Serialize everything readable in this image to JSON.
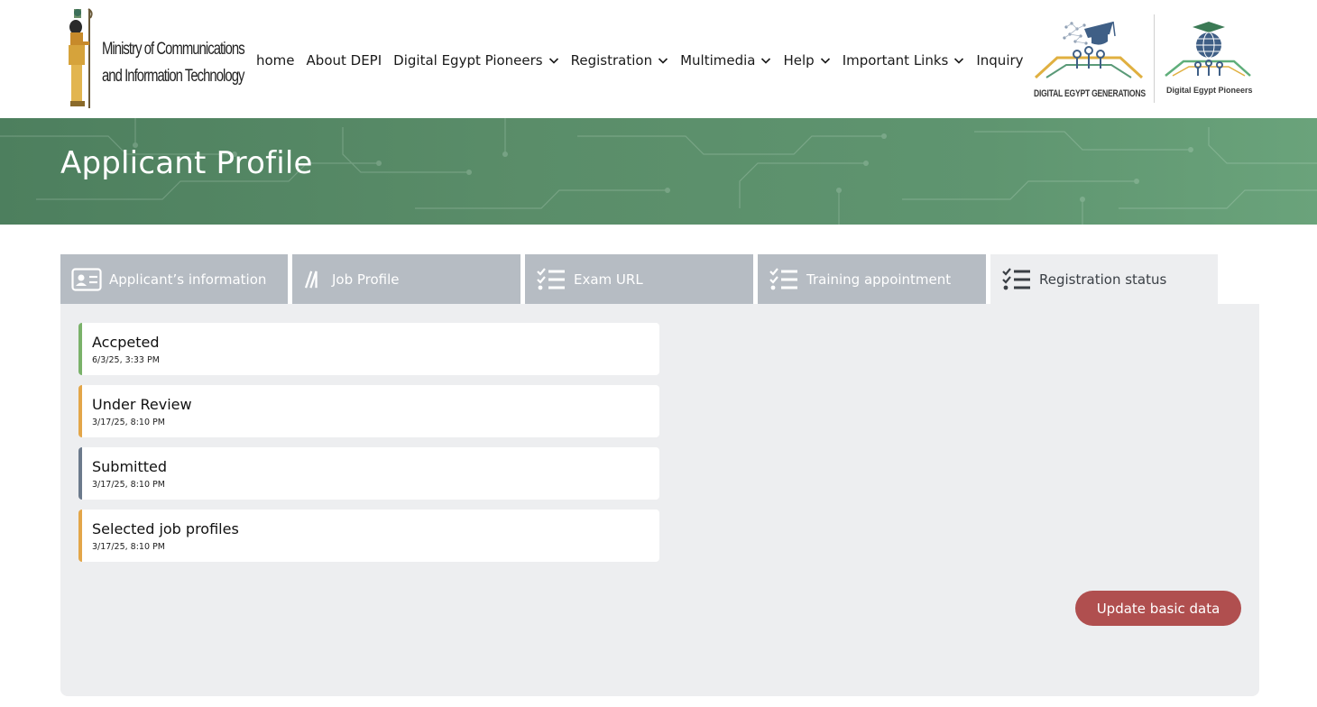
{
  "header": {
    "ministry_logo": {
      "line1": "Ministry of Communications",
      "line2": "and Information Technology"
    },
    "nav": [
      {
        "label": "home",
        "dropdown": false
      },
      {
        "label": "About DEPI",
        "dropdown": false
      },
      {
        "label": "Digital Egypt Pioneers",
        "dropdown": true
      },
      {
        "label": "Registration",
        "dropdown": true
      },
      {
        "label": "Multimedia",
        "dropdown": true
      },
      {
        "label": "Help",
        "dropdown": true
      },
      {
        "label": "Important Links",
        "dropdown": true
      },
      {
        "label": "Inquiry",
        "dropdown": false
      }
    ],
    "brand_logos": {
      "generations": "DIGITAL EGYPT GENERATIONS",
      "pioneers": "Digital Egypt Pioneers"
    }
  },
  "banner": {
    "title": "Applicant Profile"
  },
  "tabs": [
    {
      "label": "Applicant’s information",
      "icon": "id-card-icon",
      "active": false
    },
    {
      "label": "Job Profile",
      "icon": "slashes-icon",
      "active": false
    },
    {
      "label": "Exam URL",
      "icon": "checklist-icon",
      "active": false
    },
    {
      "label": "Training appointment",
      "icon": "checklist-icon",
      "active": false
    },
    {
      "label": "Registration status",
      "icon": "checklist-icon",
      "active": true
    }
  ],
  "statuses": [
    {
      "title": "Accpeted",
      "time": "6/3/25, 3:33 PM",
      "color": "#7ab26a"
    },
    {
      "title": "Under Review",
      "time": "3/17/25, 8:10 PM",
      "color": "#e3a649"
    },
    {
      "title": "Submitted",
      "time": "3/17/25, 8:10 PM",
      "color": "#6c7a8c"
    },
    {
      "title": "Selected job profiles",
      "time": "3/17/25, 8:10 PM",
      "color": "#e3a649"
    }
  ],
  "update_button": "Update basic data",
  "colors": {
    "banner_green": "#5a8d69",
    "tab_inactive": "#b6bcc3",
    "panel_bg": "#edeef0",
    "button_red": "#b04f4f"
  }
}
